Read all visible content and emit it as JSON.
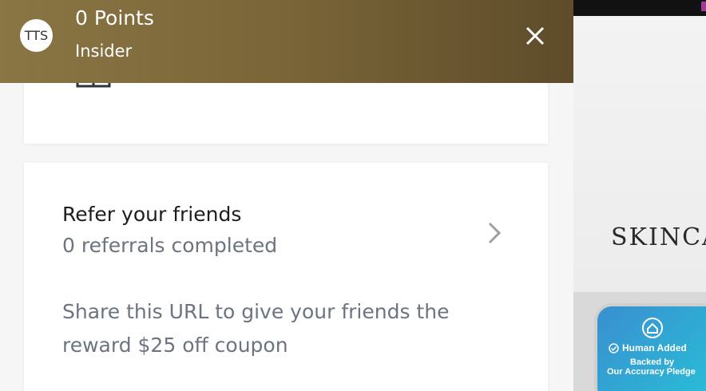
{
  "header": {
    "avatar_initials": "TTS",
    "points": "0 Points",
    "tier": "Insider",
    "close_icon": "close-icon",
    "gradient_colors": [
      "#8a7544",
      "#5e4c2a"
    ]
  },
  "rewards_card": {
    "icon": "gift-icon"
  },
  "referral": {
    "title": "Refer your friends",
    "subtitle": "0 referrals completed",
    "share_text": "Share this URL to give your friends the reward $25 off coupon",
    "chevron_icon": "chevron-right-icon"
  },
  "background_page": {
    "hero_text": "SKINCA",
    "accent_color": "#a23a9a"
  },
  "pledge_badge": {
    "icon": "pledge-logo-icon",
    "title": "Human Added",
    "line2": "Backed by",
    "line3": "Our Accuracy Pledge",
    "colors": [
      "#3a8fd0",
      "#27c2d8"
    ]
  }
}
